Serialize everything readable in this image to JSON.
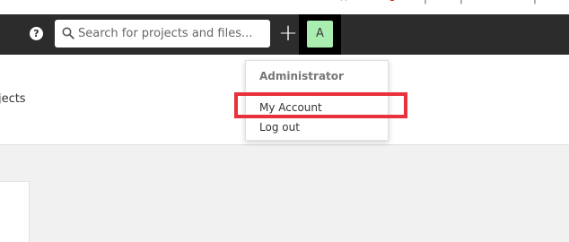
{
  "browser": {
    "glyphs": [
      "☆",
      "●",
      "│",
      "│",
      "│"
    ]
  },
  "navbar": {
    "help_icon": "question-circle-icon",
    "help_glyph": "?",
    "search": {
      "placeholder": "Search for projects and files...",
      "value": "",
      "icon": "search-icon"
    },
    "add_glyph": "+",
    "avatar_initial": "A",
    "avatar_color": "#a9eeb0"
  },
  "page": {
    "partial_title": "ojects"
  },
  "dropdown": {
    "header": "Administrator",
    "items": [
      {
        "label": "My Account",
        "highlighted": true
      },
      {
        "label": "Log out"
      }
    ]
  },
  "colors": {
    "navbar_bg": "#2c2c2c",
    "highlight": "#e8313a",
    "body_bg": "#f1f1f1"
  }
}
